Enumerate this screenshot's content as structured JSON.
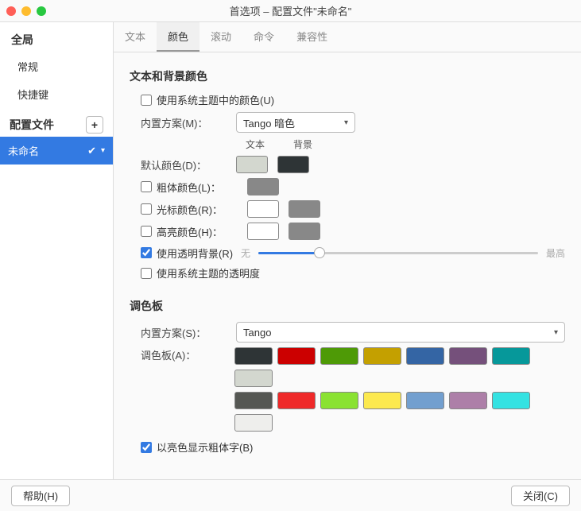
{
  "window": {
    "title": "首选项 – 配置文件\"未命名\""
  },
  "sidebar": {
    "header_global": "全局",
    "items": [
      "常规",
      "快捷键"
    ],
    "header_profiles": "配置文件",
    "selected_profile": "未命名"
  },
  "tabs": [
    "文本",
    "颜色",
    "滚动",
    "命令",
    "兼容性"
  ],
  "active_tab": "颜色",
  "section1": {
    "title": "文本和背景颜色",
    "use_system_theme": "使用系统主题中的颜色(U)",
    "builtin_label": "内置方案(M)：",
    "builtin_value": "Tango 暗色",
    "col_text": "文本",
    "col_bg": "背景",
    "rows": {
      "default": {
        "label": "默认颜色(D)：",
        "text": "#d3d7cf",
        "bg": "#2e3436"
      },
      "bold": {
        "label": "粗体颜色(L)：",
        "text": "#888888",
        "bg": null,
        "disabled": true
      },
      "cursor": {
        "label": "光标颜色(R)：",
        "text": "#ffffff",
        "bg": "#888888",
        "disabled": true
      },
      "highlight": {
        "label": "高亮颜色(H)：",
        "text": "#ffffff",
        "bg": "#888888",
        "disabled": true
      }
    },
    "use_transparent": "使用透明背景(R)",
    "use_transparent_checked": true,
    "slider_min": "无",
    "slider_max": "最高",
    "use_sys_trans": "使用系统主题的透明度"
  },
  "section2": {
    "title": "调色板",
    "builtin_label": "内置方案(S)：",
    "builtin_value": "Tango",
    "palette_label": "调色板(A)：",
    "colors_row1": [
      "#2e3436",
      "#cc0000",
      "#4e9a06",
      "#c4a000",
      "#3465a4",
      "#75507b",
      "#06989a",
      "#d3d7cf"
    ],
    "colors_row2": [
      "#555753",
      "#ef2929",
      "#8ae232",
      "#fce94f",
      "#729fcf",
      "#ad7fa8",
      "#34e2e2",
      "#eeeeec"
    ],
    "bright_bold": "以亮色显示粗体字(B)",
    "bright_bold_checked": true
  },
  "footer": {
    "help": "帮助(H)",
    "close": "关闭(C)"
  }
}
